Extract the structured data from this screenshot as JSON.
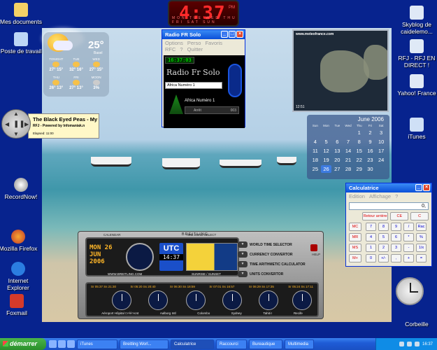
{
  "desktop_icons": {
    "mes_documents": "Mes documents",
    "poste_de_travail": "Poste de travail",
    "recordnow": "RecordNow!",
    "mozilla": "Mozilla Firefox",
    "internet_explorer": "Internet Explorer",
    "foxmail": "Foxmail",
    "skyblog": "Skyblog de caidelemo...",
    "rfj": "RFJ - RFJ EN DIRECT !",
    "yahoo": "Yahoo! France",
    "itunes": "iTunes",
    "corbeille": "Corbeille"
  },
  "clock": {
    "time": "4:37",
    "ampm": "PM",
    "days": "MON TUE WED THU FRI SAT SUN"
  },
  "weather": {
    "temp": "25°",
    "city": "Basel",
    "row1": [
      {
        "label": "TONIGHT",
        "temps": "27° 15°"
      },
      {
        "label": "TUE",
        "temps": "32° 16°"
      },
      {
        "label": "WED",
        "temps": "27° 15°"
      }
    ],
    "row2": [
      {
        "label": "THU",
        "temps": "26° 13°"
      },
      {
        "label": "FRI",
        "temps": "27° 13°"
      },
      {
        "label": "MOON",
        "temps": "3%"
      }
    ]
  },
  "player": {
    "title": "The Black Eyed Peas - My",
    "subtitle": "RFJ - Powered by Infomaniak.n",
    "elapsed": "Elapsed: 11:00"
  },
  "radio": {
    "title": "Radio FR Solo",
    "menu": [
      "Options",
      "Perso",
      "Favoris",
      "RFC",
      "?",
      "Quitter"
    ],
    "digital": "16:37:03",
    "logo": "Radio Fr Solo",
    "station": "Africa Numéro 1",
    "now_playing": "Africa Numéro 1",
    "status": "Arrêt",
    "count": "003"
  },
  "satellite": {
    "url": "www.meteofrance.com",
    "time": "12:51"
  },
  "calendar": {
    "month": "June 2006",
    "day_names": [
      "Sun",
      "Mon",
      "Tue",
      "Wed",
      "Thu",
      "Fri",
      "Sat"
    ],
    "days": [
      "",
      "",
      "",
      "",
      "1",
      "2",
      "3",
      "4",
      "5",
      "6",
      "7",
      "8",
      "9",
      "10",
      "11",
      "12",
      "13",
      "14",
      "15",
      "16",
      "17",
      "18",
      "19",
      "20",
      "21",
      "22",
      "23",
      "24",
      "25",
      "26",
      "27",
      "28",
      "29",
      "30",
      ""
    ],
    "today": "26"
  },
  "calculator": {
    "title": "Calculatrice",
    "menu": [
      "Edition",
      "Affichage",
      "?"
    ],
    "display": "0,",
    "row0": [
      "Retour arrière",
      "CE",
      "C"
    ],
    "rows": [
      [
        "MC",
        "7",
        "8",
        "9",
        "/",
        "Rac"
      ],
      [
        "MR",
        "4",
        "5",
        "6",
        "*",
        "%"
      ],
      [
        "MS",
        "1",
        "2",
        "3",
        "-",
        "1/x"
      ],
      [
        "M+",
        "0",
        "+/-",
        ",",
        "+",
        "="
      ]
    ]
  },
  "breitling": {
    "brand": "BREITLING",
    "date_line1": "MON 26",
    "date_line2": "JUN",
    "date_line3": "2006",
    "utc": "UTC",
    "utc_time": "14:37",
    "calendar_label": "CALENDAR",
    "timezone_label": "TIME ZONE SELECT",
    "website": "WWW.BREITLING.COM",
    "sunrise_label": "SUNRISE / SUNSET",
    "menu": [
      "WORLD TIME SELECTOR",
      "CURRENCY CONVERTOR",
      "TIME ARITHMETIC CALCULATOR",
      "UNITS CONVERTOR"
    ],
    "help": "HELP",
    "select": "SELECT",
    "cities": [
      "Aéroport Hôpital Delémont",
      "Aalborg Intl",
      "Colombo",
      "Sydney",
      "Tahiti I",
      "Recife"
    ],
    "times": [
      "Sr 05:37 Ss 21:30",
      "Sr 05:20 Ss 20:40",
      "Sr 06:30 Ss 18:59",
      "Sr 07:01 Ss 16:57",
      "Sr 06:29 Ss 17:35",
      "Sr 05:24 Ss 17:11"
    ]
  },
  "taskbar": {
    "start": "démarrer",
    "items": [
      "iTunes",
      "Breitling Worl...",
      "Calculatrice",
      "Raccourci",
      "Bureautique",
      "Multimedia"
    ],
    "clock": "16:37"
  }
}
